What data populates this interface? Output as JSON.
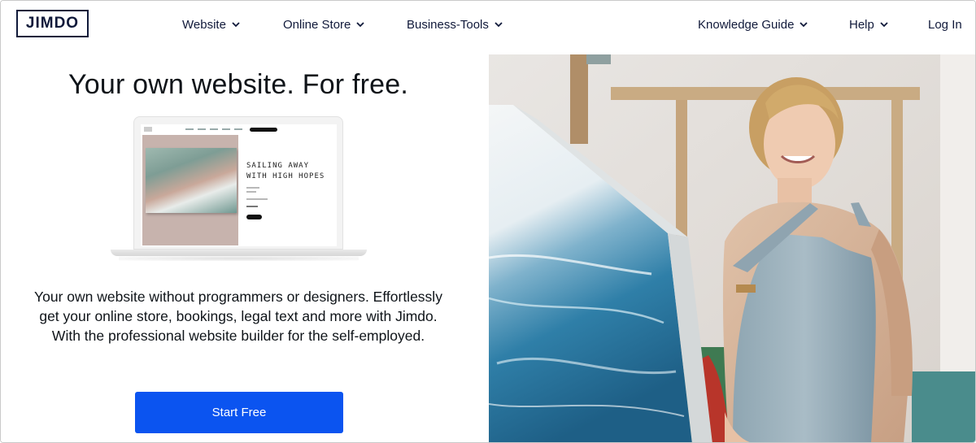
{
  "header": {
    "logo_text": "JIMDO",
    "nav": [
      {
        "label": "Website",
        "icon": "chevron-down-icon"
      },
      {
        "label": "Online Store",
        "icon": "chevron-down-icon"
      },
      {
        "label": "Business-Tools",
        "icon": "chevron-down-icon"
      },
      {
        "label": "Knowledge Guide",
        "icon": "chevron-down-icon"
      },
      {
        "label": "Help",
        "icon": "chevron-down-icon"
      }
    ],
    "login_label": "Log In"
  },
  "hero": {
    "headline": "Your own website. For free.",
    "mockup": {
      "title_line_1": "SAILING AWAY",
      "title_line_2": "WITH HIGH HOPES"
    },
    "description": "Your own website without programmers or designers. Effortlessly get your online store, bookings, legal text and more with Jimdo. With the professional website builder for the self-employed.",
    "cta_label": "Start Free"
  },
  "colors": {
    "brand_dark": "#10193a",
    "cta_blue": "#0b54f0"
  }
}
